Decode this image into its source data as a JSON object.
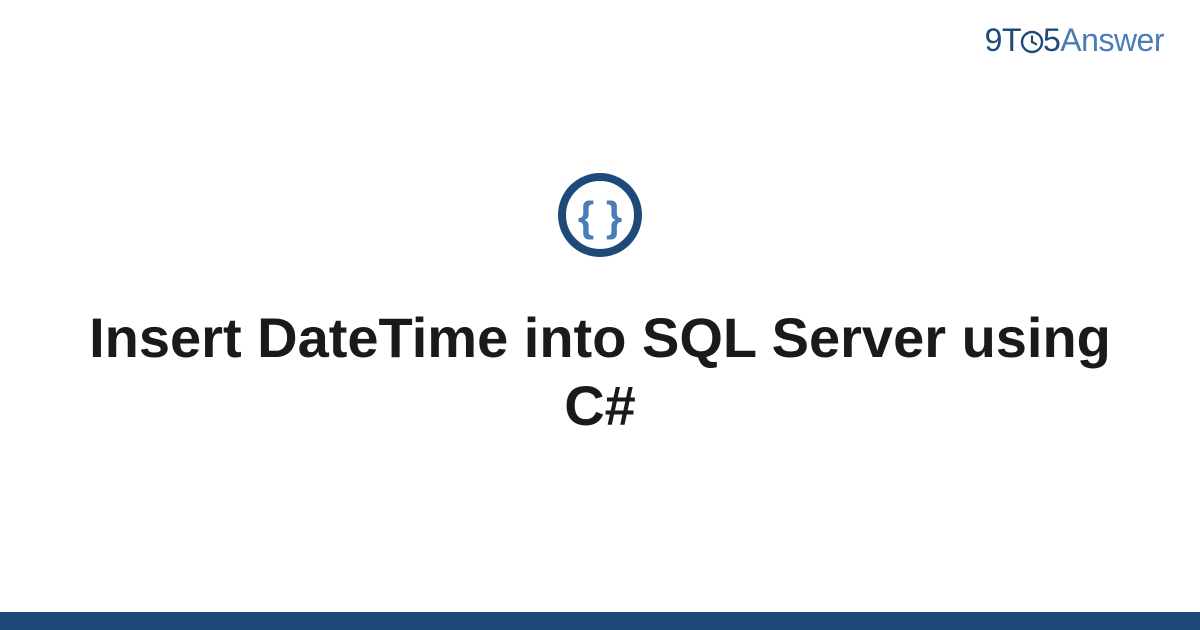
{
  "brand": {
    "part1": "9T",
    "part2": "5",
    "part3": "Answer"
  },
  "icon": {
    "name": "code-braces",
    "ring_color": "#1e4a7a",
    "glyph_color": "#4a7db8"
  },
  "title": "Insert DateTime into SQL Server using C#",
  "colors": {
    "brand_dark": "#1e4a7a",
    "brand_light": "#4a7db8",
    "bottom_bar": "#1e4a7a"
  }
}
